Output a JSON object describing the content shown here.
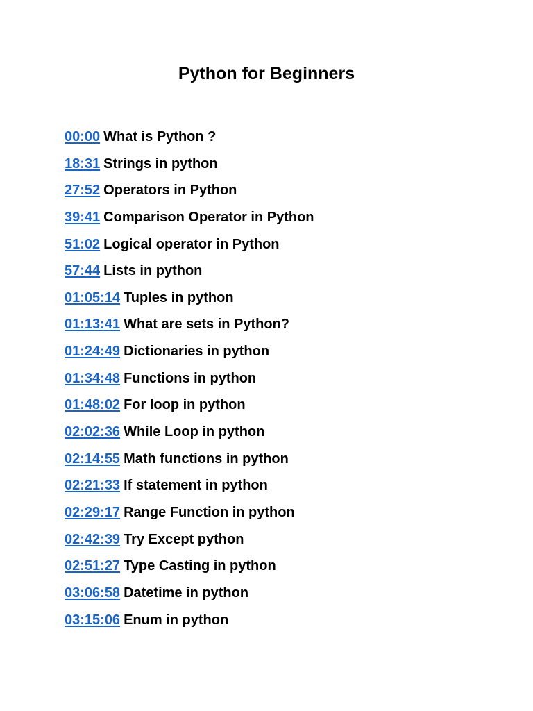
{
  "title": "Python for Beginners",
  "entries": [
    {
      "time": "00:00",
      "topic": "What is Python ?"
    },
    {
      "time": "18:31",
      "topic": "Strings in python"
    },
    {
      "time": "27:52",
      "topic": "Operators in Python"
    },
    {
      "time": "39:41",
      "topic": "Comparison Operator in Python"
    },
    {
      "time": "51:02",
      "topic": "Logical operator in Python"
    },
    {
      "time": "57:44",
      "topic": "Lists in python"
    },
    {
      "time": "01:05:14",
      "topic": "Tuples in python"
    },
    {
      "time": "01:13:41",
      "topic": "What are sets in Python?"
    },
    {
      "time": "01:24:49",
      "topic": "Dictionaries in python"
    },
    {
      "time": "01:34:48",
      "topic": "Functions in python"
    },
    {
      "time": "01:48:02",
      "topic": "For loop in python"
    },
    {
      "time": "02:02:36",
      "topic": "While Loop in python"
    },
    {
      "time": "02:14:55",
      "topic": "Math functions in python"
    },
    {
      "time": "02:21:33",
      "topic": "If statement in python"
    },
    {
      "time": "02:29:17",
      "topic": "Range Function in python"
    },
    {
      "time": "02:42:39",
      "topic": "Try Except python"
    },
    {
      "time": "02:51:27",
      "topic": "Type Casting in python"
    },
    {
      "time": "03:06:58",
      "topic": "Datetime in python"
    },
    {
      "time": "03:15:06",
      "topic": "Enum in python"
    }
  ],
  "colors": {
    "link": "#1a64c4",
    "text": "#000000",
    "background": "#ffffff"
  }
}
